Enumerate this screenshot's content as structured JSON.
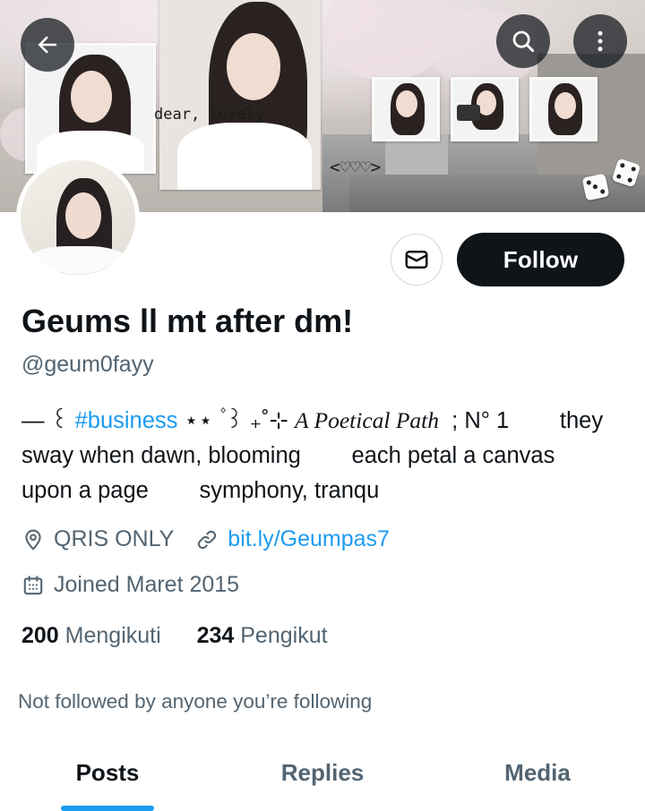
{
  "header": {
    "back_icon": "arrow-left-icon",
    "search_icon": "search-icon",
    "more_icon": "more-vertical-icon",
    "banner_caption": "dear, lovely",
    "banner_hearts": "<♡♡♡>"
  },
  "profile": {
    "display_name": "Geums ll mt after dm!",
    "handle": "@geum0fayy",
    "bio": {
      "line1_prefix": "— ꒰ ",
      "line1_hashtag": "#business",
      "line1_stars": " ⋆⋆ ۫ ꒱ ₊˚⊹ ",
      "line1_serif": "A Poetical Path",
      "line1_suffix": "  ; N° 1        they",
      "line2": "sway when dawn, blooming        each petal a canvas",
      "line3": "upon a page        symphony, tranqu"
    },
    "location": "QRIS ONLY",
    "website": "bit.ly/Geumpas7",
    "joined": "Joined Maret 2015",
    "following_count": "200",
    "following_label": "Mengikuti",
    "followers_count": "234",
    "followers_label": "Pengikut",
    "not_followed_text": "Not followed by anyone you’re following"
  },
  "actions": {
    "message_icon": "envelope-icon",
    "follow_label": "Follow"
  },
  "tabs": [
    {
      "label": "Posts",
      "active": true
    },
    {
      "label": "Replies",
      "active": false
    },
    {
      "label": "Media",
      "active": false
    }
  ],
  "colors": {
    "accent": "#1d9bf0",
    "text_primary": "#0f1419",
    "text_secondary": "#536471",
    "follow_bg": "#0f1419"
  }
}
